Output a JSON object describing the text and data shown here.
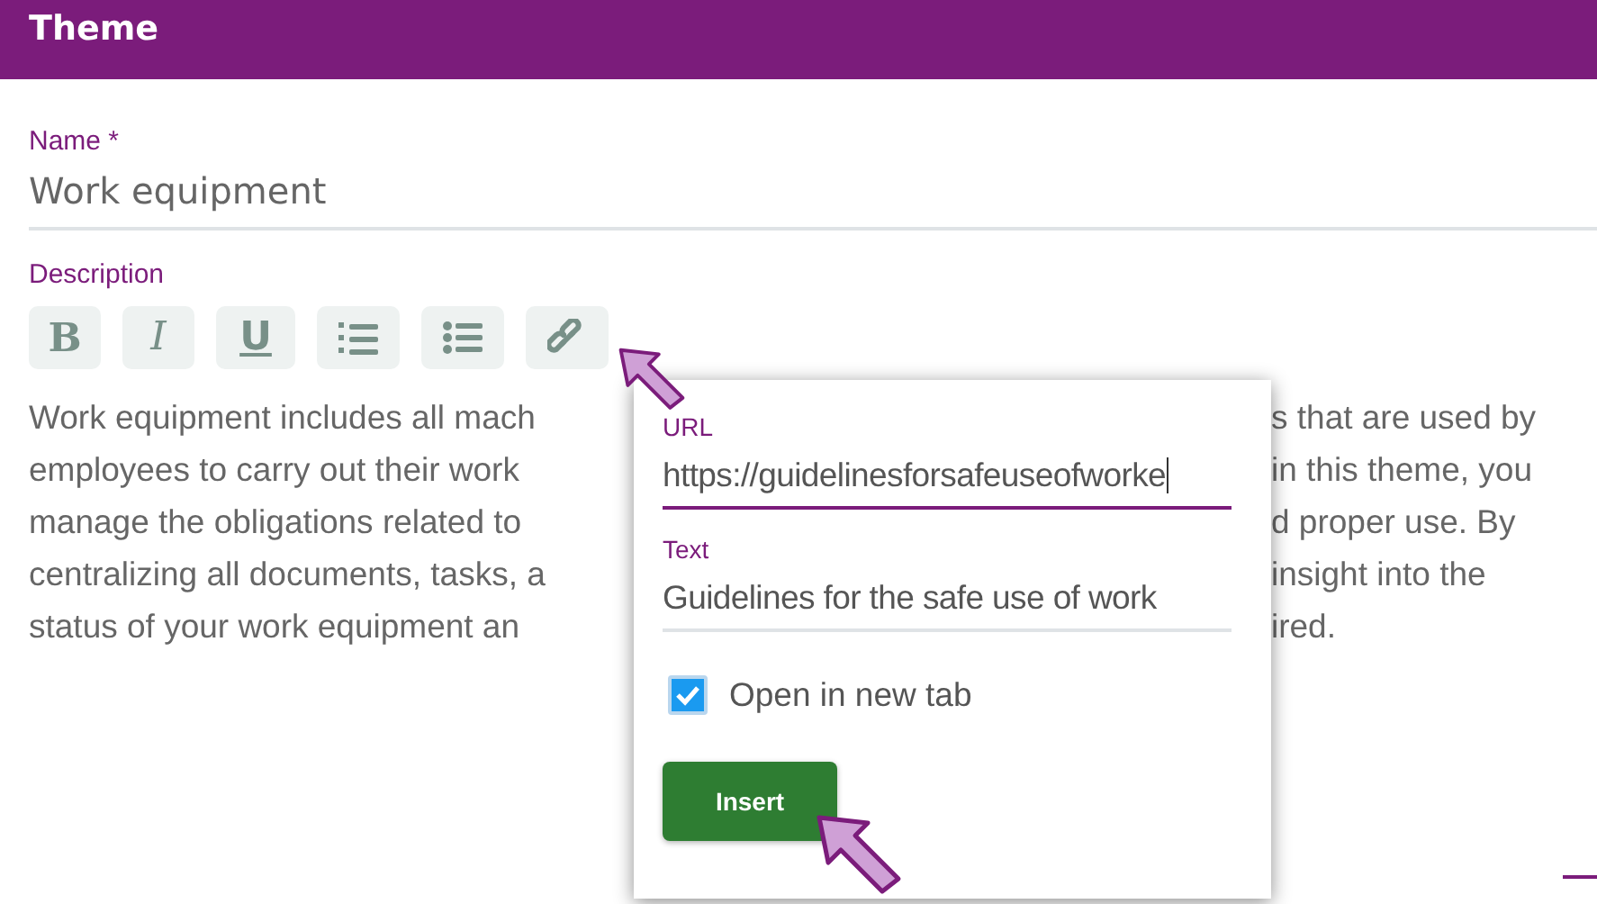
{
  "header": {
    "title": "Theme"
  },
  "name_field": {
    "label": "Name *",
    "value": "Work equipment"
  },
  "description": {
    "label": "Description",
    "toolbar": [
      {
        "kind": "bold",
        "label": "B"
      },
      {
        "kind": "italic",
        "label": "I"
      },
      {
        "kind": "underline",
        "label": "U"
      },
      {
        "kind": "numbered-list"
      },
      {
        "kind": "bullet-list"
      },
      {
        "kind": "link"
      }
    ],
    "lines": [
      {
        "left": "Work equipment includes all mach",
        "right": "s that are used by"
      },
      {
        "left": "employees to carry out their work",
        "right": "in this theme, you"
      },
      {
        "left": "manage the obligations related to",
        "right": "d proper use. By"
      },
      {
        "left": "centralizing all documents, tasks, a",
        "right": "insight into the"
      },
      {
        "left": "status of your work equipment an",
        "right": "ired."
      }
    ]
  },
  "link_dialog": {
    "url": {
      "label": "URL",
      "value": "https://guidelinesforsafeuseofworke",
      "focused": true
    },
    "text": {
      "label": "Text",
      "value": "Guidelines for the safe use of work",
      "focused": false
    },
    "checkbox": {
      "label": "Open in new tab",
      "checked": true
    },
    "button": "Insert"
  }
}
